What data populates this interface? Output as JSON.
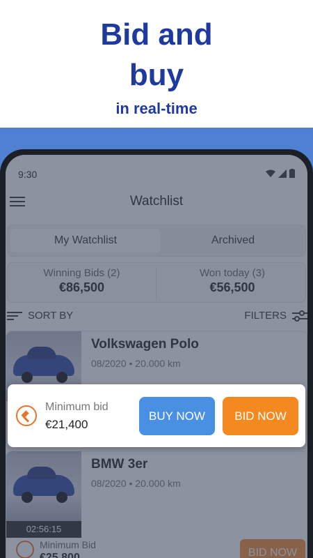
{
  "headline": {
    "line1": "Bid and",
    "line2": "buy",
    "line3": "in real-time"
  },
  "status": {
    "time": "9:30"
  },
  "appbar": {
    "title": "Watchlist"
  },
  "tabs": {
    "selected": "My Watchlist",
    "other": "Archived"
  },
  "stats": {
    "winning_label": "Winning Bids (2)",
    "winning_value": "€86,500",
    "won_label": "Won today (3)",
    "won_value": "€56,500"
  },
  "sort": {
    "sort_label": "SORT BY",
    "filters_label": "FILTERS"
  },
  "cards": [
    {
      "name": "Volkswagen Polo",
      "meta": "08/2020 • 20.000 km"
    },
    {
      "name": "BMW 3er",
      "meta": "08/2020 • 20.000 km",
      "timer": "02:56:15",
      "min_label": "Minimum Bid",
      "min_value": "€25,800",
      "bid_label": "BID NOW"
    }
  ],
  "bid_popup": {
    "min_label": "Minimum bid",
    "min_value": "€21,400",
    "buy_label": "BUY NOW",
    "bid_label": "BID NOW"
  },
  "colors": {
    "headline": "#1f3a9e",
    "buy": "#4a90e2",
    "bid": "#f3891f"
  }
}
